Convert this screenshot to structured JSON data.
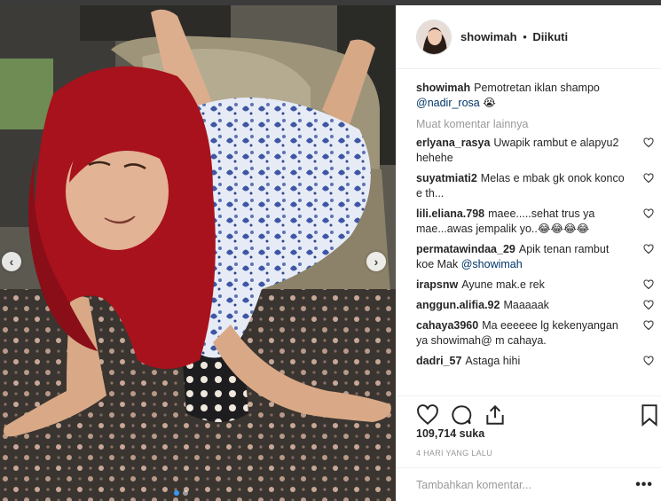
{
  "post": {
    "username": "showimah",
    "separator": "•",
    "follow_status": "Diikuti",
    "caption_user": "showimah",
    "caption_text": "Pemotretan iklan shampo",
    "caption_mention": "@nadir_rosa",
    "caption_emoji": "😭",
    "load_more": "Muat komentar lainnya",
    "likes": "109,714 suka",
    "time_ago": "4 HARI YANG LALU",
    "add_comment_placeholder": "Tambahkan komentar...",
    "more_options": "•••"
  },
  "comments": [
    {
      "user": "erlyana_rasya",
      "text": "Uwapik rambut e alapyu2 hehehe"
    },
    {
      "user": "suyatmiati2",
      "text": "Melas e mbak gk onok konco e th..."
    },
    {
      "user": "lili.eliana.798",
      "text": "maee.....sehat trus ya mae...awas jempalik yo..😂😂😂😂"
    },
    {
      "user": "permatawindaa_29",
      "text": "Apik tenan rambut koe Mak",
      "mention": "@showimah"
    },
    {
      "user": "irapsnw",
      "text": "Ayune mak.e rek"
    },
    {
      "user": "anggun.alifia.92",
      "text": "Maaaaak"
    },
    {
      "user": "cahaya3960",
      "text": "Ma eeeeee lg kekenyangan ya showimah@ m cahaya."
    },
    {
      "user": "dadri_57",
      "text": "Astaga hihi"
    }
  ],
  "icons": {
    "like": "heart-icon",
    "comment": "comment-icon",
    "share": "share-icon",
    "save": "bookmark-icon",
    "prev": "chevron-left-icon",
    "next": "chevron-right-icon"
  },
  "nav": {
    "prev_glyph": "‹",
    "next_glyph": "›"
  },
  "colors": {
    "link": "#003569",
    "muted": "#999999",
    "text": "#262626",
    "hair": "#a8121c",
    "dress": "#5a73b8"
  }
}
